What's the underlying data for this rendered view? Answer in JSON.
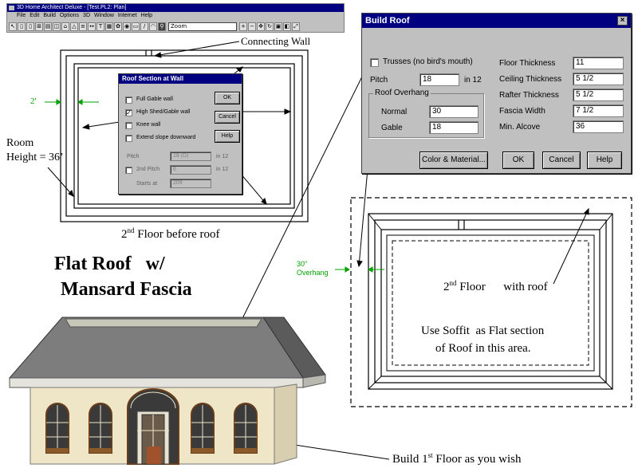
{
  "app": {
    "title": "3D Home Architect Deluxe - [Test.PL2: Plan]",
    "menu": [
      "File",
      "Edit",
      "Build",
      "Options",
      "3D",
      "Window",
      "Internet",
      "Help"
    ],
    "zoom_value": "Zoom"
  },
  "annotations": {
    "connecting_wall": "Connecting Wall",
    "dimension_left": "2'",
    "room_height_line1": "Room",
    "room_height_line2": "Height = 36’",
    "floor_before_roof_prefix": "2",
    "floor_before_roof_sup": "nd",
    "floor_before_roof_suffix": " Floor before roof",
    "heading_line1": "Flat Roof   w/",
    "heading_line2": "Mansard Fascia",
    "overhang_line1": "30\"",
    "overhang_line2": "Overhang",
    "floor_with_roof_prefix": "2",
    "floor_with_roof_sup": "nd",
    "floor_with_roof_suffix": " Floor      with roof",
    "soffit_line1": "Use Soffit  as Flat section",
    "soffit_line2": "of Roof in this area.",
    "build_first_prefix": "Build 1",
    "build_first_sup": "st",
    "build_first_suffix": " Floor as you wish"
  },
  "roof_section_dialog": {
    "title": "Roof Section at Wall",
    "full_gable_label": "Full Gable wall",
    "full_gable_checked": false,
    "high_shed_label": "High Shed/Gable wall",
    "high_shed_checked": true,
    "high_shed_mark": "✓",
    "knee_wall_label": "Knee wall",
    "knee_wall_checked": false,
    "extend_slope_label": "Extend slope downward",
    "extend_slope_checked": false,
    "pitch_label": "Pitch",
    "pitch_value": "18 (D)",
    "pitch_unit": "in 12",
    "second_pitch_label": "2nd Pitch",
    "second_pitch_value": "6",
    "second_pitch_unit": "in 12",
    "starts_at_label": "Starts at",
    "starts_at_value": "209",
    "ok_label": "OK",
    "cancel_label": "Cancel",
    "help_label": "Help"
  },
  "build_roof_dialog": {
    "title": "Build Roof",
    "close_glyph": "×",
    "trusses_label": "Trusses (no bird's mouth)",
    "trusses_checked": false,
    "pitch_label": "Pitch",
    "pitch_value": "18",
    "pitch_unit": "in 12",
    "overhang_group": "Roof Overhang",
    "normal_label": "Normal",
    "normal_value": "30",
    "gable_label": "Gable",
    "gable_value": "18",
    "floor_thickness_label": "Floor Thickness",
    "floor_thickness_value": "11",
    "ceiling_thickness_label": "Ceiling Thickness",
    "ceiling_thickness_value": "5 1/2",
    "rafter_thickness_label": "Rafter Thickness",
    "rafter_thickness_value": "5 1/2",
    "fascia_width_label": "Fascia Width",
    "fascia_width_value": "7 1/2",
    "min_alcove_label": "Min. Alcove",
    "min_alcove_value": "36",
    "color_material_label": "Color & Material...",
    "ok_label": "OK",
    "cancel_label": "Cancel",
    "help_label": "Help"
  },
  "colors": {
    "dialog_title": "#000080",
    "dialog_bg": "#c0c0c0",
    "dimension_green": "#00a000",
    "roof_gray": "#7d7d7d",
    "wall_cream": "#efe6c8",
    "window_wood": "#6a3d1a"
  }
}
